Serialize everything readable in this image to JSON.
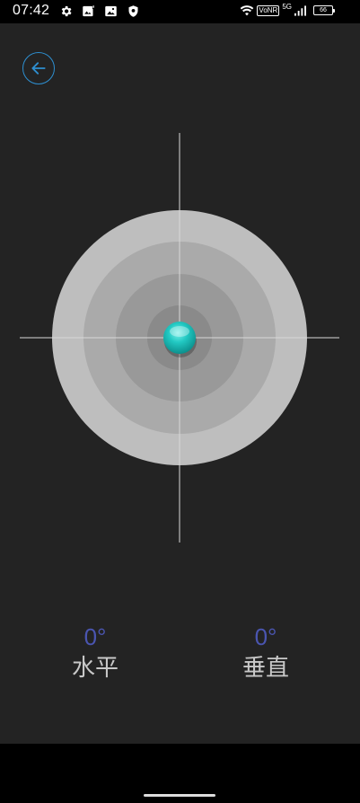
{
  "status_bar": {
    "time": "07:42",
    "left_icons": [
      "gear-icon",
      "image-notification-icon",
      "gallery-icon",
      "shield-icon"
    ],
    "volte_label": "VoNR",
    "network_label": "5G",
    "battery_level": "66"
  },
  "toolbar": {
    "back_icon": "arrow-left-icon",
    "accent_color": "#2e8fd0"
  },
  "level": {
    "bubble_color": "#1fbfbb",
    "ring_colors": [
      "#bebebe",
      "#aaaaaa",
      "#999999",
      "#8a8a8a"
    ],
    "bubble_offset_x": 0,
    "bubble_offset_y": 0
  },
  "readings": {
    "horizontal_value": "0°",
    "horizontal_label": "水平",
    "vertical_value": "0°",
    "vertical_label": "垂直",
    "value_color": "#4a55b0"
  }
}
